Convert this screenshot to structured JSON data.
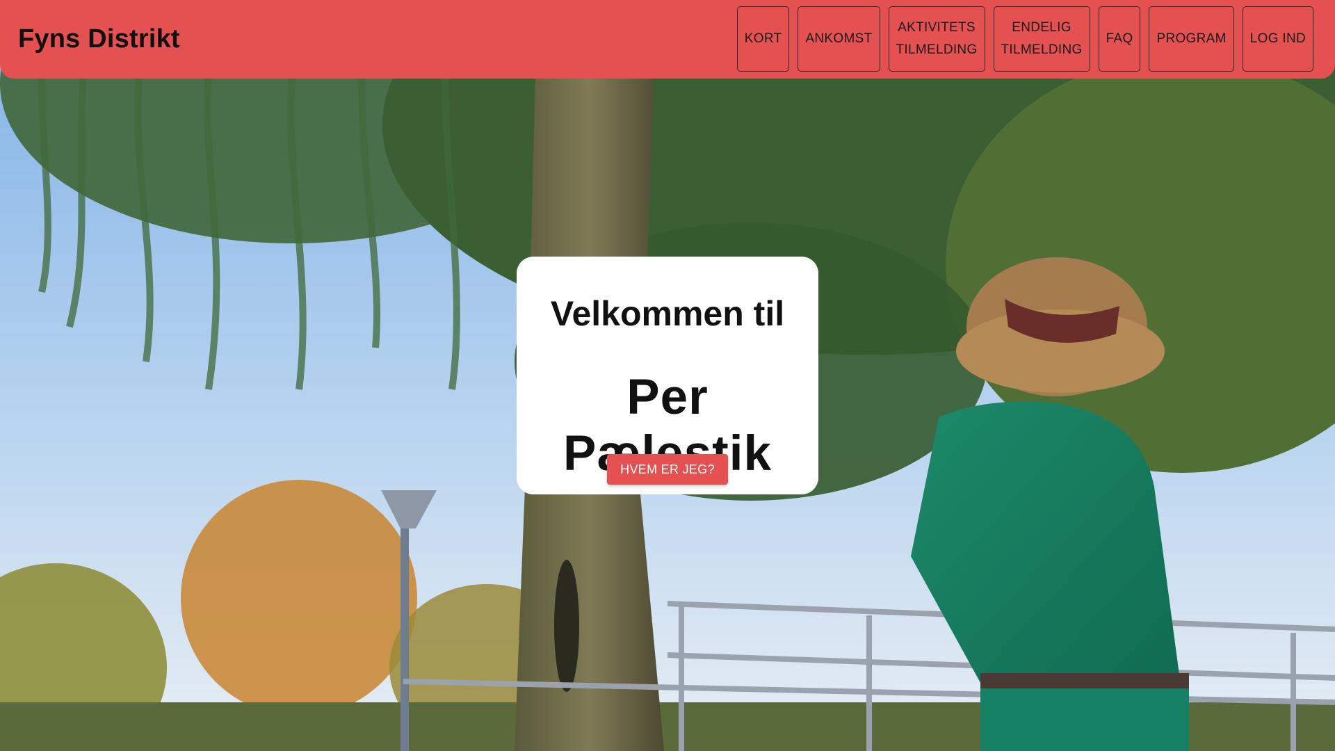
{
  "header": {
    "brand": "Fyns Distrikt",
    "accent_color": "#e55050",
    "nav": [
      {
        "label": "KORT"
      },
      {
        "label": "ANKOMST"
      },
      {
        "line1": "AKTIVITETS",
        "line2": "TILMELDING"
      },
      {
        "line1": "ENDELIG",
        "line2": "TILMELDING"
      },
      {
        "label": "FAQ"
      },
      {
        "label": "PROGRAM"
      },
      {
        "label": "LOG IND"
      }
    ]
  },
  "hero": {
    "background": "photo-willow-tree-scout",
    "greeting": "Velkommen til",
    "title": "Per Pælestik",
    "button_label": "HVEM ER JEG?"
  }
}
